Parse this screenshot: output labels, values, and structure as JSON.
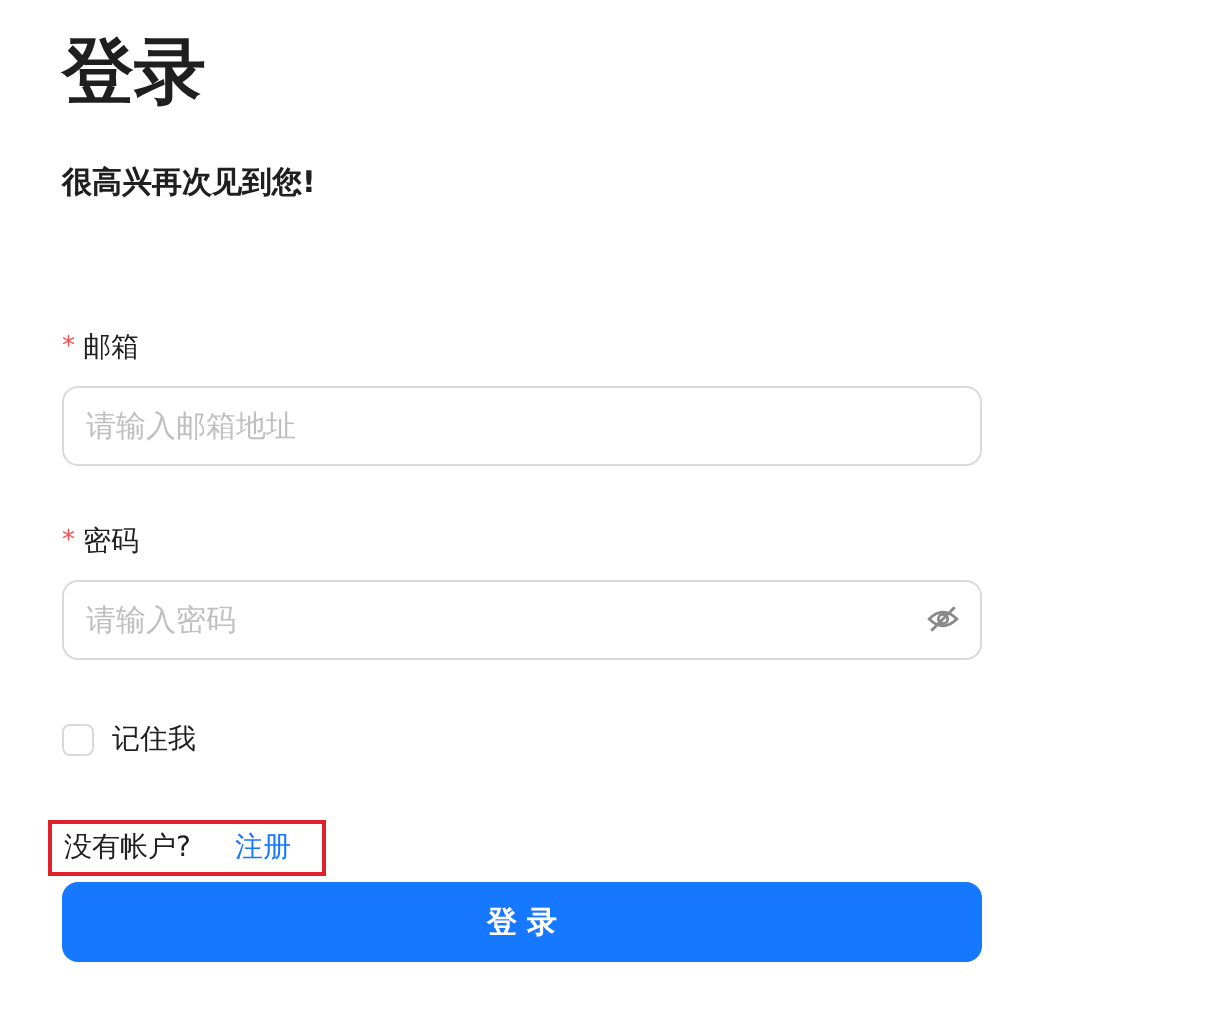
{
  "title": "登录",
  "subtitle": "很高兴再次见到您!",
  "fields": [
    {
      "label": "邮箱",
      "required_mark": "*",
      "placeholder": "请输入邮箱地址",
      "kind": "text"
    },
    {
      "label": "密码",
      "required_mark": "*",
      "placeholder": "请输入密码",
      "kind": "password"
    }
  ],
  "remember": {
    "label": "记住我",
    "checked": false
  },
  "signup": {
    "prompt": "没有帐户?",
    "link": "注册",
    "highlighted": true
  },
  "submit": "登 录"
}
